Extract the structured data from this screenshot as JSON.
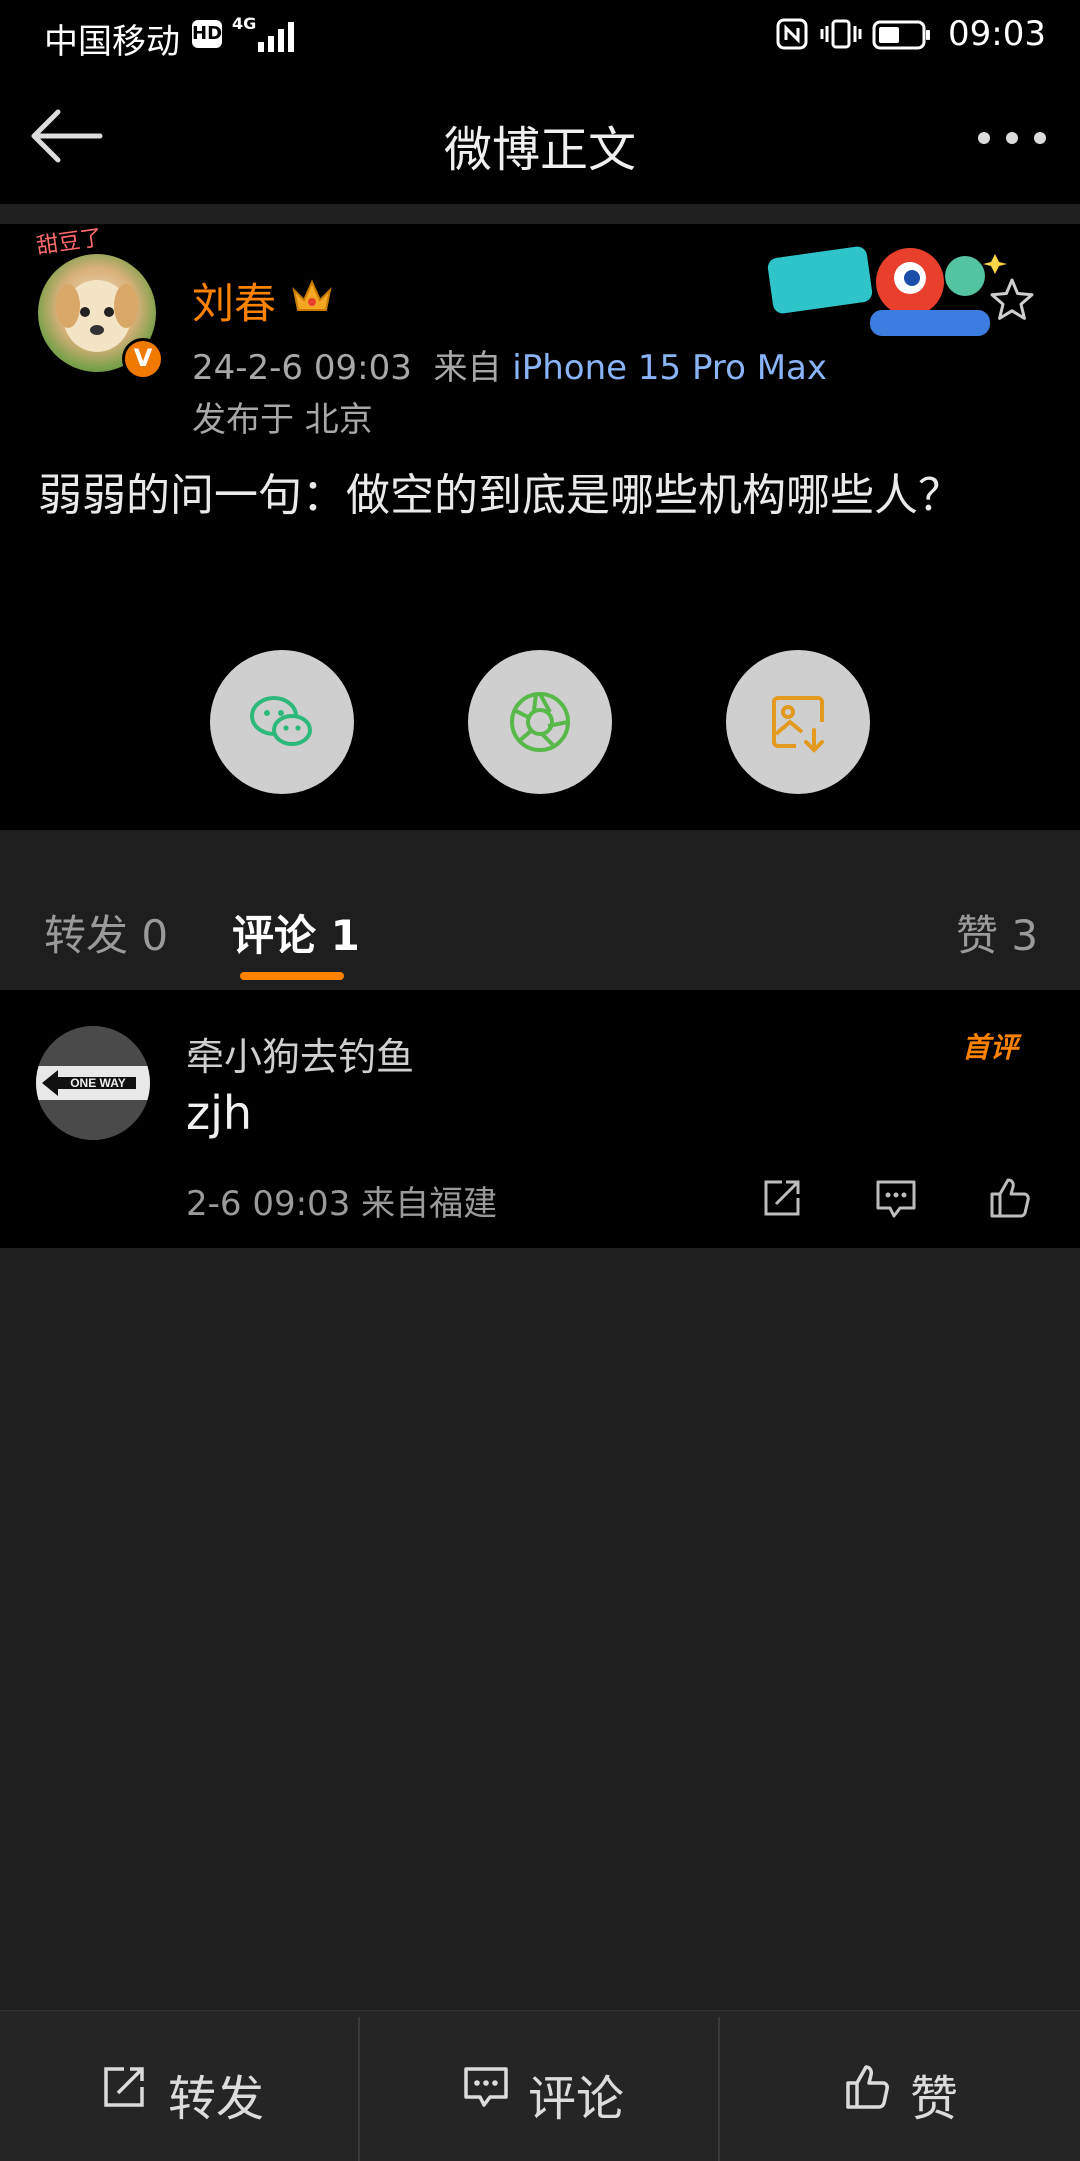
{
  "status_bar": {
    "carrier": "中国移动",
    "hd": "HD",
    "network": "4G",
    "time": "09:03"
  },
  "nav": {
    "title": "微博正文",
    "back_icon": "back-arrow-icon",
    "more_icon": "more-dots-icon"
  },
  "post": {
    "author": "刘春",
    "avatar_tag": "甜豆了",
    "verified_badge": "V",
    "timestamp": "24-2-6 09:03",
    "source_prefix": "来自",
    "device": "iPhone 15 Pro Max",
    "location": "发布于 北京",
    "text": "弱弱的问一句：做空的到底是哪些机构哪些人？",
    "share_buttons": [
      "wechat-icon",
      "moments-icon",
      "save-image-icon"
    ]
  },
  "tabs": {
    "repost": "转发 0",
    "comments": "评论 1",
    "likes": "赞 3"
  },
  "comment": {
    "name": "牵小狗去钓鱼",
    "text": "zjh",
    "meta": "2-6 09:03  来自福建",
    "first_badge": "首评"
  },
  "bottom_bar": {
    "repost": "转发",
    "comment": "评论",
    "like": "赞"
  },
  "colors": {
    "accent": "#ff8200",
    "device_link": "#8ab4f8",
    "background": "#1e1e1e",
    "card": "#000000"
  }
}
